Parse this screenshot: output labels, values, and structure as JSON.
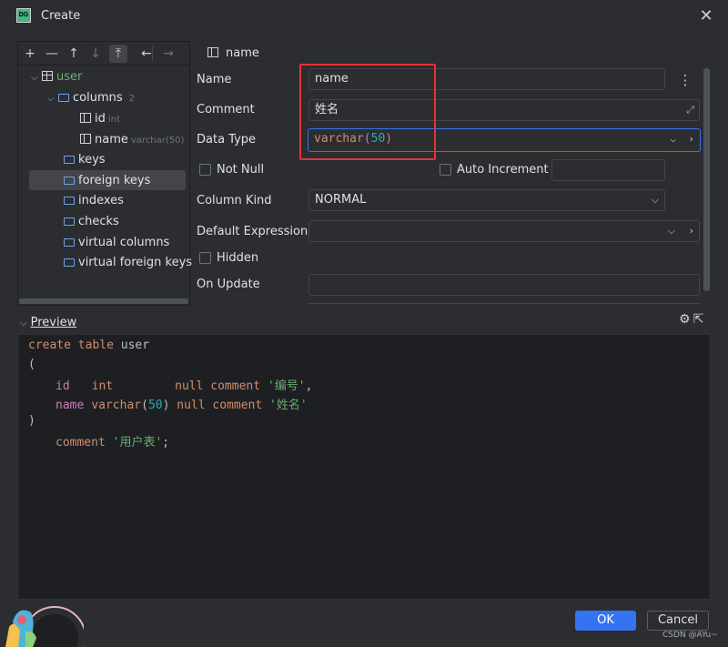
{
  "window": {
    "logo": "DG",
    "title": "Create"
  },
  "toolbar": {
    "icons": [
      "plus-icon",
      "minus-icon",
      "move-up-icon",
      "move-down-icon",
      "move-to-top-icon",
      "back-arrow-icon",
      "forward-arrow-icon"
    ],
    "add": "+",
    "remove": "—",
    "up": "↑",
    "down": "↓",
    "top": "⤒",
    "back": "←",
    "forward": "→"
  },
  "tree": {
    "table": "user",
    "columns_label": "columns",
    "columns_count": "2",
    "col_id": "id",
    "col_id_type": "int",
    "col_name": "name",
    "col_name_type": "varchar(50)",
    "keys": "keys",
    "foreign_keys": "foreign keys",
    "indexes": "indexes",
    "checks": "checks",
    "virtual_columns": "virtual columns",
    "virtual_foreign_keys": "virtual foreign keys"
  },
  "header": {
    "selected": "name"
  },
  "form": {
    "name_label": "Name",
    "name_value": "name",
    "comment_label": "Comment",
    "comment_value": "姓名",
    "data_type_label": "Data Type",
    "data_type_base": "varchar",
    "data_type_open": "(",
    "data_type_size": "50",
    "data_type_close": ")",
    "not_null_label": "Not Null",
    "auto_increment_label": "Auto Increment",
    "column_kind_label": "Column Kind",
    "column_kind_value": "NORMAL",
    "default_expression_label": "Default Expression",
    "hidden_label": "Hidden",
    "on_update_label": "On Update"
  },
  "preview": {
    "label": "Preview",
    "code": {
      "l1_kw": "create table ",
      "l1_name": "user",
      "l2": "(",
      "l3_col": "id",
      "l3_type": "int",
      "l3_null": "null comment ",
      "l3_str": "'编号'",
      "l3_end": ",",
      "l4_col": "name",
      "l4_type": "varchar",
      "l4_open": "(",
      "l4_num": "50",
      "l4_close": ")",
      "l4_null": " null comment ",
      "l4_str": "'姓名'",
      "l5": ")",
      "l6_kw": "comment ",
      "l6_str": "'用户表'",
      "l6_end": ";"
    }
  },
  "buttons": {
    "ok": "OK",
    "cancel": "Cancel"
  },
  "watermark": "CSDN @AYu~",
  "colors": {
    "accent": "#3574f0",
    "highlight_box": "#e5323a",
    "keyword": "#cf8e6d",
    "string": "#6aab73",
    "number": "#2aacb8"
  }
}
